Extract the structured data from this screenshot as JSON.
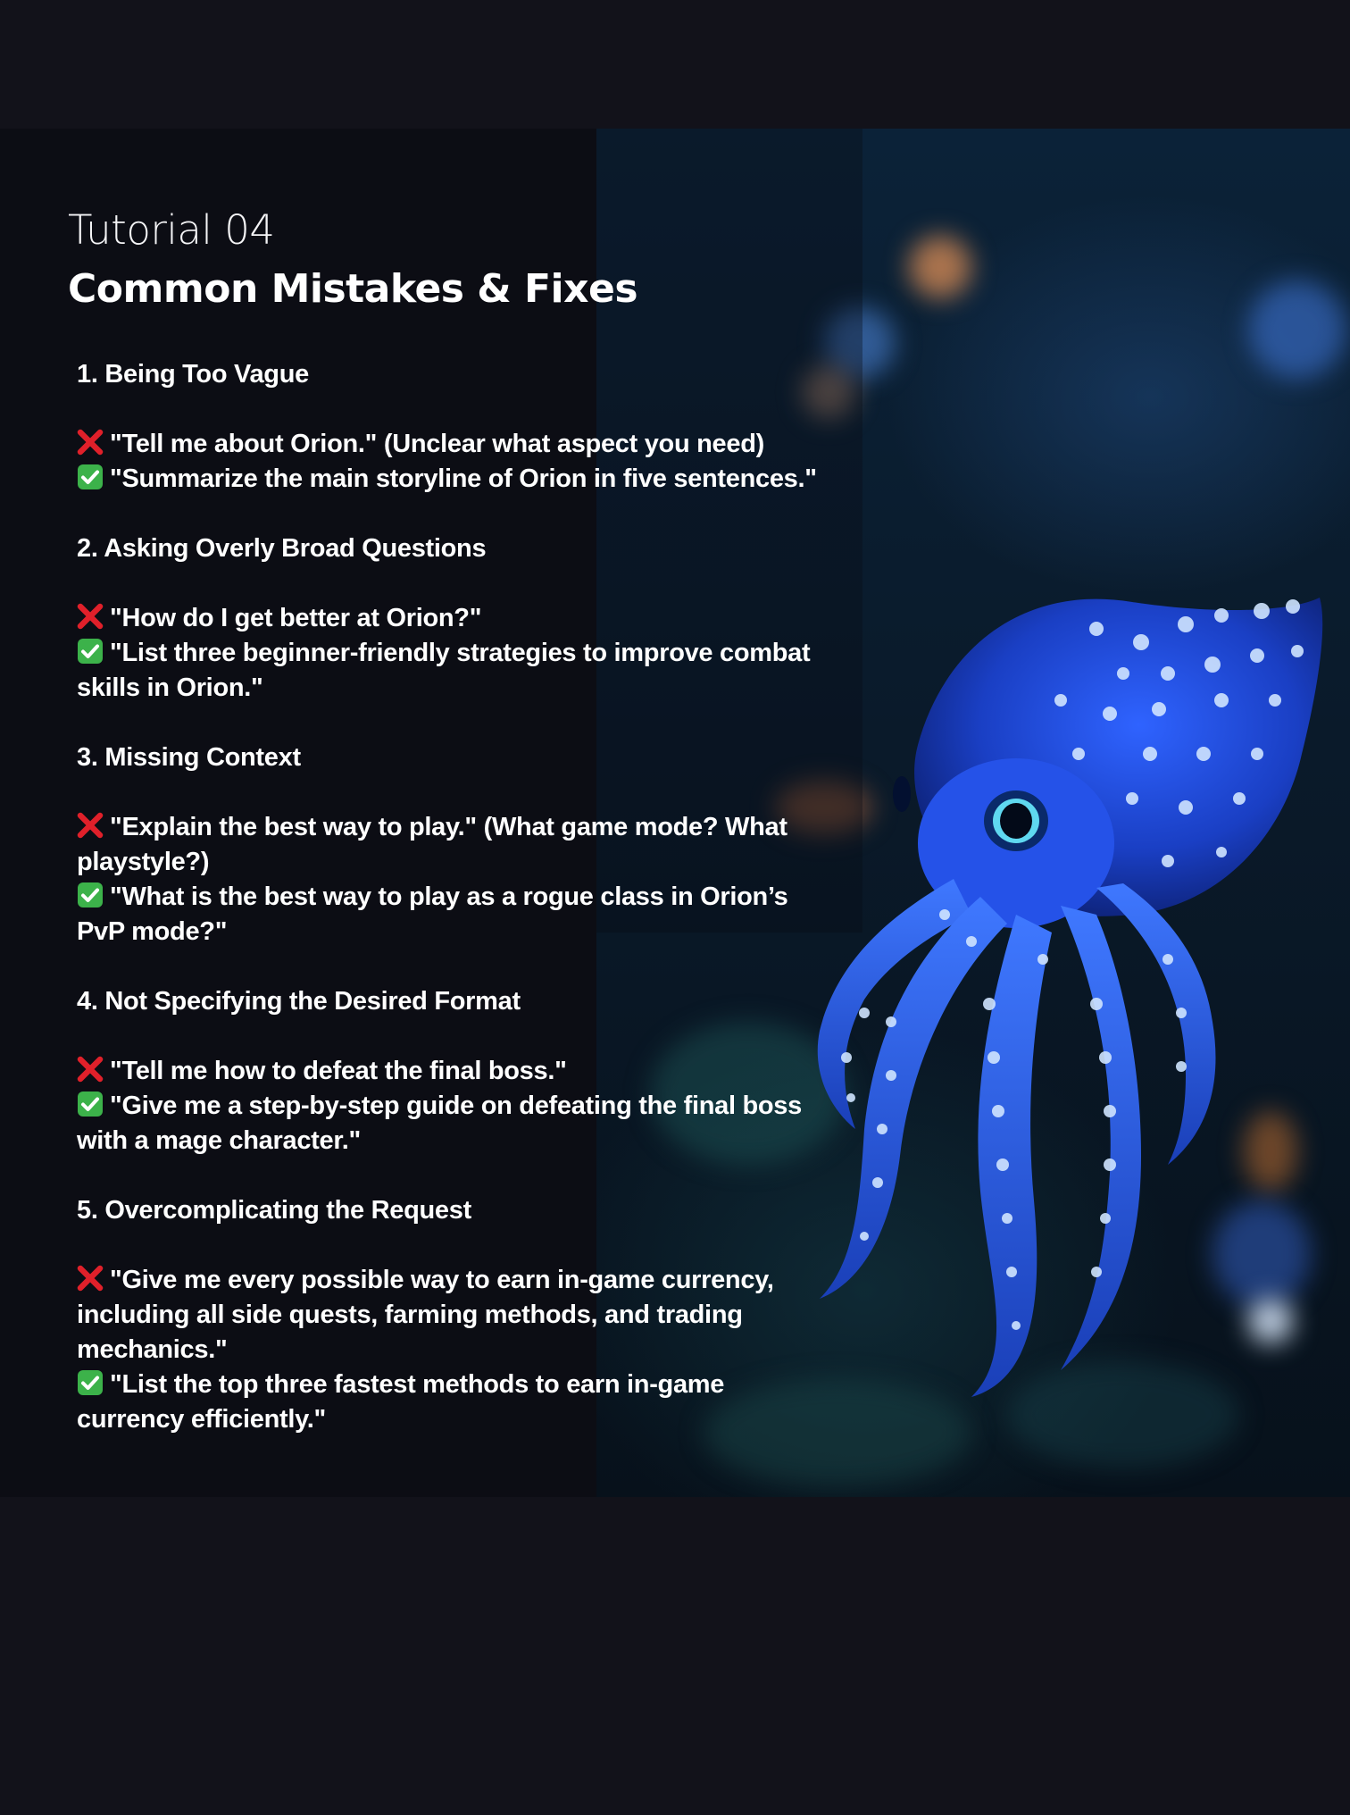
{
  "header": {
    "eyebrow": "Tutorial 04",
    "title": "Common Mistakes & Fixes"
  },
  "colors": {
    "background": "#12121a",
    "wrong_mark": "#e0202a",
    "right_mark": "#3cb24a",
    "creature": "#2a5cf0"
  },
  "icons": {
    "wrong": "cross-mark-icon",
    "right": "check-mark-icon"
  },
  "sections": [
    {
      "heading": "1. Being Too Vague",
      "wrong": "\"Tell me about Orion.\" (Unclear what aspect you need)",
      "right": "\"Summarize the main storyline of Orion in five sentences.\""
    },
    {
      "heading": "2. Asking Overly Broad Questions",
      "wrong": "\"How do I get better at Orion?\"",
      "right": "\"List three beginner-friendly strategies to improve combat skills in Orion.\""
    },
    {
      "heading": "3. Missing Context",
      "wrong": "\"Explain the best way to play.\" (What game mode? What playstyle?)",
      "right": "\"What is the best way to play as a rogue class in Orion’s PvP mode?\""
    },
    {
      "heading": "4. Not Specifying the Desired Format",
      "wrong": "\"Tell me how to defeat the final boss.\"",
      "right": "\"Give me a step-by-step guide on defeating the final boss with a mage character.\""
    },
    {
      "heading": "5. Overcomplicating the Request",
      "wrong": "\"Give me every possible way to earn in-game currency, including all side quests, farming methods, and trading mechanics.\"",
      "right": "\"List the top three fastest methods to earn in-game currency efficiently.\""
    }
  ]
}
